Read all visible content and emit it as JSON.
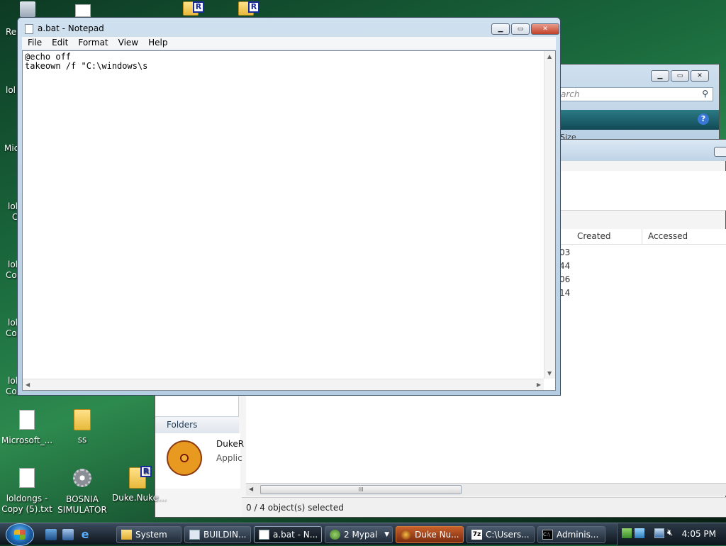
{
  "desktop": {
    "icons": [
      {
        "label": "Microsoft_...",
        "type": "doc"
      },
      {
        "label": "ss",
        "type": "folder"
      },
      {
        "label": "loldongs - Copy (5).txt",
        "type": "doc"
      },
      {
        "label": "BOSNIA SIMULATOR",
        "type": "gear"
      },
      {
        "label": "Duke.Nuke...",
        "type": "folder-r"
      },
      {
        "label": "Duke.Nuke...",
        "type": "folder-r"
      }
    ],
    "partial_labels": [
      "Re",
      "lol",
      "Mic",
      "lol",
      "C",
      "lol",
      "Co",
      "lol",
      "Co",
      "lol",
      "Co"
    ]
  },
  "notepad": {
    "title": "a.bat - Notepad",
    "menu": [
      "File",
      "Edit",
      "Format",
      "View",
      "Help"
    ],
    "content": "@echo off\ntakeown /f \"C:\\windows\\s"
  },
  "explorer_back": {
    "search_placeholder": "arch",
    "column_header": "Size"
  },
  "explorer_front": {
    "columns": [
      "Created",
      "Accessed"
    ],
    "row_fragments": [
      "03",
      "44",
      "06",
      "14"
    ],
    "folders_label": "Folders",
    "item_name": "DukeR",
    "item_type": "Applic",
    "status": "0 / 4 object(s) selected"
  },
  "taskbar": {
    "buttons": [
      {
        "label": "System",
        "icon": "folder-icon"
      },
      {
        "label": "BUILDIN...",
        "icon": "window-icon"
      },
      {
        "label": "a.bat - N...",
        "icon": "notepad-icon"
      },
      {
        "label": "2 Mypal",
        "icon": "mypal-icon"
      },
      {
        "label": "Duke Nu...",
        "icon": "nuke-icon"
      },
      {
        "label": "C:\\Users...",
        "icon": "7zip-icon"
      },
      {
        "label": "Adminis...",
        "icon": "cmd-icon"
      }
    ],
    "clock": "4:05 PM"
  }
}
